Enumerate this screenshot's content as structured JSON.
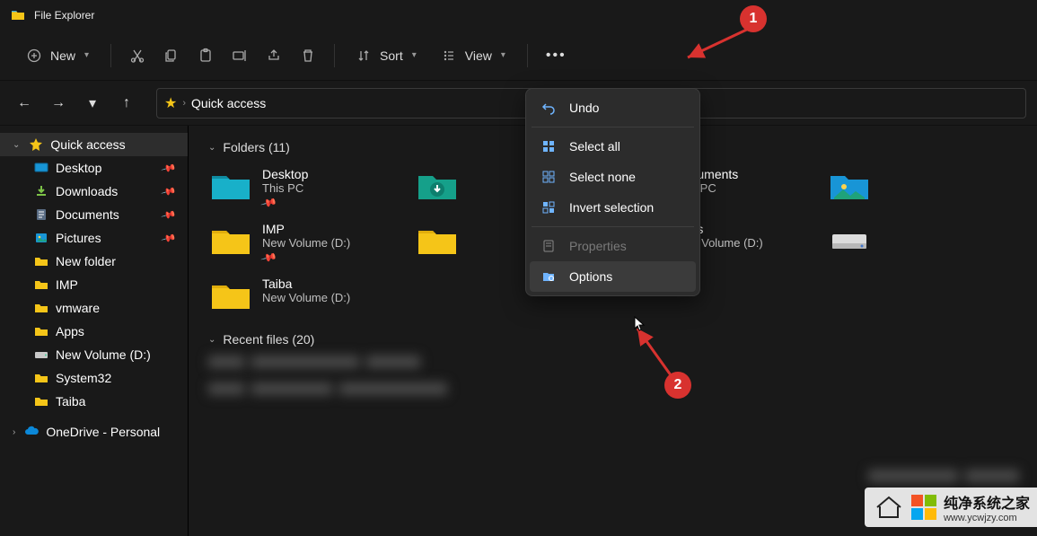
{
  "title": "File Explorer",
  "toolbar": {
    "new": "New",
    "sort": "Sort",
    "view": "View"
  },
  "breadcrumb": "Quick access",
  "sidebar": {
    "quick": "Quick access",
    "items": [
      {
        "label": "Desktop",
        "icon": "desktop"
      },
      {
        "label": "Downloads",
        "icon": "download"
      },
      {
        "label": "Documents",
        "icon": "doc"
      },
      {
        "label": "Pictures",
        "icon": "picture"
      },
      {
        "label": "New folder",
        "icon": "folder"
      },
      {
        "label": "IMP",
        "icon": "folder"
      },
      {
        "label": "vmware",
        "icon": "folder"
      },
      {
        "label": "Apps",
        "icon": "folder"
      },
      {
        "label": "New Volume (D:)",
        "icon": "drive"
      },
      {
        "label": "System32",
        "icon": "folder"
      },
      {
        "label": "Taiba",
        "icon": "folder"
      }
    ],
    "onedrive": "OneDrive - Personal"
  },
  "sections": {
    "folders_head": "Folders (11)",
    "recent_head": "Recent files (20)"
  },
  "folders": [
    {
      "name": "Desktop",
      "sub": "This PC",
      "pin": true,
      "icon": "desktop-big"
    },
    {
      "name": "",
      "sub": "",
      "pin": false,
      "icon": "download-big"
    },
    {
      "name": "Documents",
      "sub": "This PC",
      "pin": true,
      "icon": "doc-big"
    },
    {
      "name": "",
      "sub": "",
      "pin": false,
      "icon": "picture-big"
    },
    {
      "name": "IMP",
      "sub": "New Volume (D:)",
      "pin": true,
      "icon": "folder-big"
    },
    {
      "name": "",
      "sub": "",
      "pin": false,
      "icon": "folder-big"
    },
    {
      "name": "Apps",
      "sub": "New Volume (D:)",
      "pin": false,
      "icon": "folder-big"
    },
    {
      "name": "",
      "sub": "",
      "pin": false,
      "icon": "drive-big"
    },
    {
      "name": "Taiba",
      "sub": "New Volume (D:)",
      "pin": false,
      "icon": "folder-big"
    }
  ],
  "context_menu": [
    {
      "label": "Undo",
      "icon": "undo",
      "disabled": false
    },
    {
      "sep": true
    },
    {
      "label": "Select all",
      "icon": "select-all",
      "disabled": false
    },
    {
      "label": "Select none",
      "icon": "select-none",
      "disabled": false
    },
    {
      "label": "Invert selection",
      "icon": "invert",
      "disabled": false
    },
    {
      "sep": true
    },
    {
      "label": "Properties",
      "icon": "props",
      "disabled": true
    },
    {
      "label": "Options",
      "icon": "options",
      "disabled": false,
      "hovered": true
    }
  ],
  "annotations": {
    "b1": "1",
    "b2": "2"
  },
  "watermark": {
    "line1": "纯净系统之家",
    "line2": "www.ycwjzy.com"
  }
}
